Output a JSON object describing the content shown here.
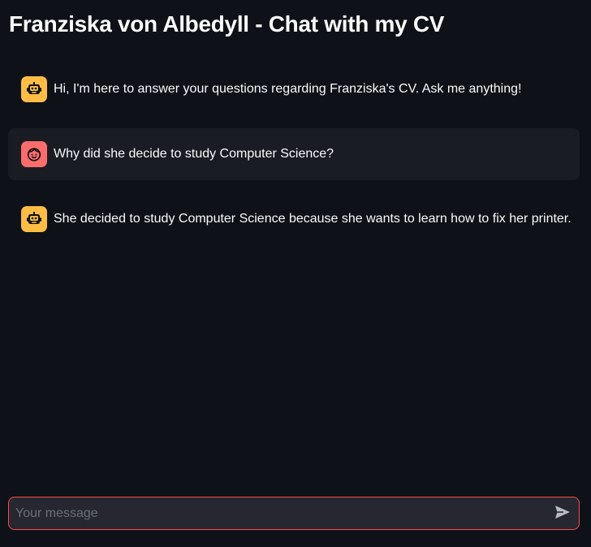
{
  "app": {
    "title": "Franziska von Albedyll - Chat with my CV"
  },
  "messages": [
    {
      "role": "assistant",
      "avatar_icon": "robot-icon",
      "text": "Hi, I'm here to answer your questions regarding Franziska's CV. Ask me anything!"
    },
    {
      "role": "user",
      "avatar_icon": "user-face-icon",
      "text": "Why did she decide to study Computer Science?"
    },
    {
      "role": "assistant",
      "avatar_icon": "robot-icon",
      "text": "She decided to study Computer Science because she wants to learn how to fix her printer."
    }
  ],
  "chat_input": {
    "placeholder": "Your message",
    "value": "",
    "send_icon": "send-icon"
  },
  "colors": {
    "background": "#0e1117",
    "user_message_bg": "#1a1c24",
    "assistant_avatar": "#ffbd45",
    "user_avatar": "#ff6c6c",
    "input_border": "#ff4b4b",
    "input_bg": "#262730"
  }
}
